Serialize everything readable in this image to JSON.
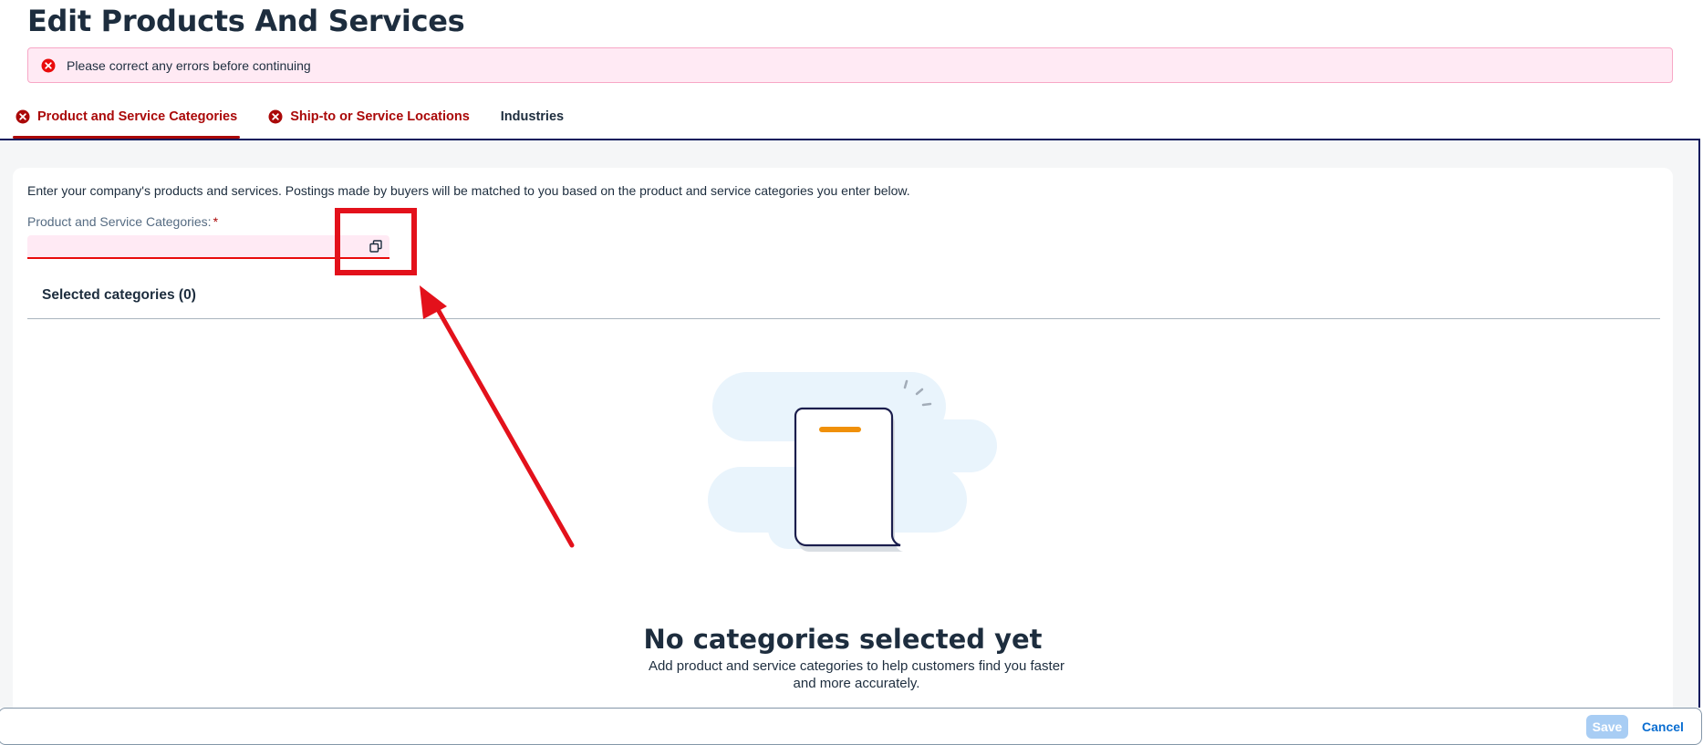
{
  "page": {
    "title": "Edit Products And Services"
  },
  "error_banner": {
    "icon": "error-icon",
    "message": "Please correct any errors before continuing"
  },
  "tabs": [
    {
      "label": "Product and Service Categories",
      "state": "error",
      "active": true
    },
    {
      "label": "Ship-to or Service Locations",
      "state": "error",
      "active": false
    },
    {
      "label": "Industries",
      "state": "normal",
      "active": false
    }
  ],
  "content": {
    "intro": "Enter your company's products and services. Postings made by buyers will be matched to you based on the product and service categories you enter below.",
    "field_label": "Product and Service Categories:",
    "required_mark": "*",
    "field_value": "",
    "value_help_icon": "value-help-icon",
    "selected_heading": "Selected categories (0)",
    "empty_title": "No categories selected yet",
    "empty_description": "Add product and service categories to help customers find you faster and more accurately."
  },
  "footer": {
    "save_label": "Save",
    "cancel_label": "Cancel"
  },
  "colors": {
    "error": "#aa0808",
    "banner_bg": "#ffeaf4",
    "annotation": "#e3111b",
    "link": "#0a6ed1",
    "save_disabled": "#a8cdf4"
  }
}
